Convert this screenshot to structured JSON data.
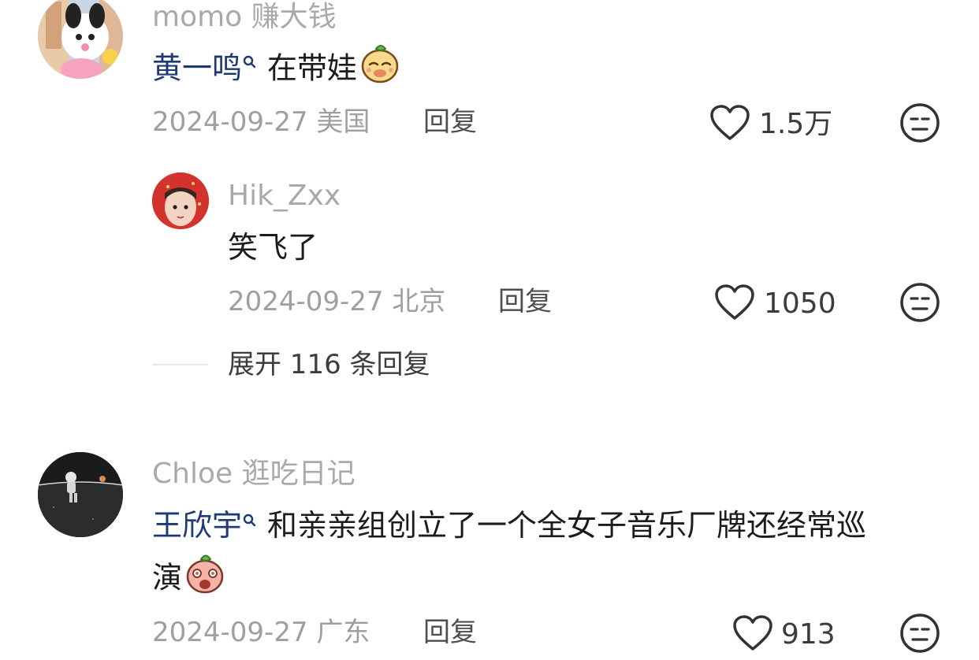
{
  "comments": [
    {
      "username": "momo 赚大钱",
      "mention": "黄一鸣",
      "text": "在带娃",
      "emoji": "mango-smile-emoji",
      "date": "2024-09-27",
      "location": "美国",
      "reply_label": "回复",
      "likes": "1.5万",
      "avatar": "kuromi-plush-avatar"
    },
    {
      "username": "Hik_Zxx",
      "text": "笑飞了",
      "date": "2024-09-27",
      "location": "北京",
      "reply_label": "回复",
      "likes": "1050",
      "avatar": "person-strawberry-hood-avatar"
    },
    {
      "username": "Chloe 逛吃日记",
      "mention": "王欣宇",
      "text_line1": "和亲亲组创立了一个全女子音乐厂牌还经常巡",
      "text_line2": "演",
      "emoji": "peach-surprised-emoji",
      "date": "2024-09-27",
      "location": "广东",
      "reply_label": "回复",
      "likes": "913",
      "avatar": "astronaut-moon-avatar"
    }
  ],
  "expand": {
    "label": "展开 116 条回复"
  },
  "icons": {
    "like": "heart-outline-icon",
    "dislike": "neutral-face-icon",
    "mention_search": "search-icon"
  },
  "colors": {
    "username": "#a9a9a9",
    "mention": "#1e3a74",
    "meta": "#9f9f9f",
    "text": "#1c1c1c"
  }
}
